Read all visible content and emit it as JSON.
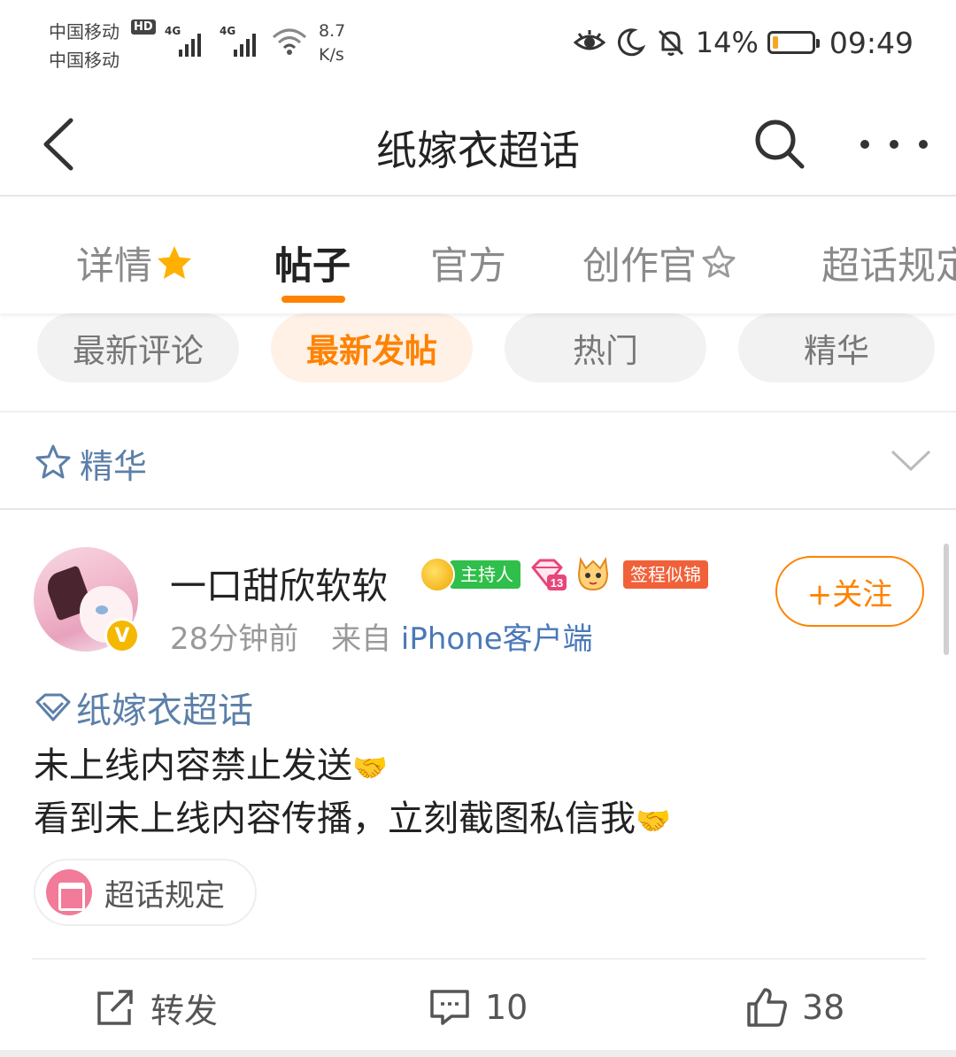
{
  "status_bar": {
    "carrier_1": "中国移动",
    "carrier_2": "中国移动",
    "hd": "HD",
    "signal_1": "4G",
    "signal_2": "4G",
    "speed_value": "8.7",
    "speed_unit": "K/s",
    "battery_percent": "14%",
    "battery_level": 0.14,
    "time": "09:49"
  },
  "nav": {
    "title": "纸嫁衣超话"
  },
  "tabs": [
    {
      "label": "详情"
    },
    {
      "label": "帖子"
    },
    {
      "label": "官方"
    },
    {
      "label": "创作官"
    },
    {
      "label": "超话规定"
    }
  ],
  "filters": [
    {
      "label": "最新评论"
    },
    {
      "label": "最新发帖"
    },
    {
      "label": "热门"
    },
    {
      "label": "精华"
    }
  ],
  "section": {
    "label": "精华"
  },
  "post": {
    "username": "一口甜欣软软",
    "host_badge": "主持人",
    "level": "13",
    "title_badge": "签程似锦",
    "follow_label": "+关注",
    "time_ago": "28分钟前",
    "from_prefix": "来自",
    "client": "iPhone客户端",
    "topic": "纸嫁衣超话",
    "line_1": "未上线内容禁止发送",
    "line_2": "看到未上线内容传播，立刻截图私信我",
    "emoji": "🤝",
    "rules_chip": "超话规定",
    "repost_label": "转发",
    "comment_count": "10",
    "like_count": "38"
  },
  "colors": {
    "accent": "#ff8200",
    "link": "#5b7fa8",
    "host_green": "#2fbf4a",
    "title_red": "#f0613a"
  }
}
